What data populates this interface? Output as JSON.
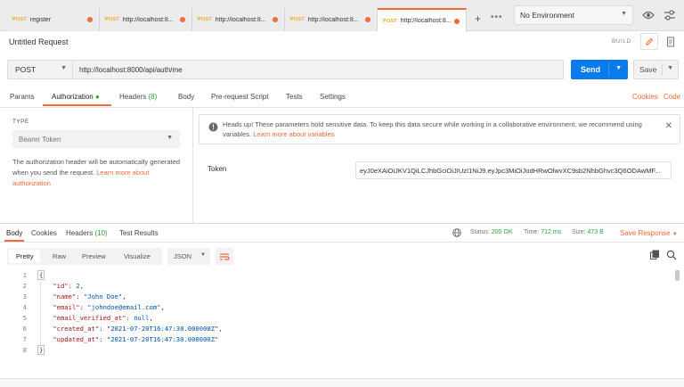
{
  "tabs": [
    {
      "method": "POST",
      "label": "register"
    },
    {
      "method": "POST",
      "label": "http://localhost:8..."
    },
    {
      "method": "POST",
      "label": "http://localhost:8..."
    },
    {
      "method": "POST",
      "label": "http://localhost:8..."
    },
    {
      "method": "POST",
      "label": "http://localhost:8..."
    }
  ],
  "tabbar": {
    "plus": "+",
    "more": "•••"
  },
  "environment": {
    "selected": "No Environment"
  },
  "request": {
    "title": "Untitled Request",
    "build_label": "BUILD",
    "method": "POST",
    "url": "http://localhost:8000/api/auth/me",
    "send_label": "Send",
    "save_label": "Save"
  },
  "request_tabs": {
    "params": "Params",
    "authorization": "Authorization",
    "headers": "Headers",
    "headers_count": "(8)",
    "body": "Body",
    "pre_request": "Pre-request Script",
    "tests": "Tests",
    "settings": "Settings",
    "cookies": "Cookies",
    "code": "Code"
  },
  "auth": {
    "type_label": "TYPE",
    "type_value": "Bearer Token",
    "desc_text": "The authorization header will be automatically generated when you send the request. ",
    "desc_link": "Learn more about authorization",
    "warning_text": "Heads up! These parameters hold sensitive data. To keep this data secure while working in a collaborative environment, we recommend using variables. ",
    "warning_link": "Learn more about variables",
    "token_label": "Token",
    "token_value": "eyJ0eXAiOiJKV1QiLCJhbGciOiJIUzI1NiJ9.eyJpc3MiOiJodHRwOlwvXC9sb2NhbGhvc3Q6ODAwMF..."
  },
  "response_tabs": {
    "body": "Body",
    "cookies": "Cookies",
    "headers": "Headers",
    "headers_count": "(10)",
    "test_results": "Test Results"
  },
  "response_status": {
    "status_label": "Status:",
    "status_value": "200 OK",
    "time_label": "Time:",
    "time_value": "712 ms",
    "size_label": "Size:",
    "size_value": "473 B",
    "save_response": "Save Response"
  },
  "response_toolbar": {
    "pretty": "Pretty",
    "raw": "Raw",
    "preview": "Preview",
    "visualize": "Visualize",
    "format": "JSON"
  },
  "response_body": {
    "line_numbers": [
      "1",
      "2",
      "3",
      "4",
      "5",
      "6",
      "7",
      "8"
    ],
    "open_brace": "{",
    "close_brace": "}",
    "fields": [
      {
        "key": "\"id\"",
        "value": "2",
        "type": "num",
        "comma": ","
      },
      {
        "key": "\"name\"",
        "value": "\"John Doe\"",
        "type": "str",
        "comma": ","
      },
      {
        "key": "\"email\"",
        "value": "\"johndoe@email.com\"",
        "type": "str",
        "comma": ","
      },
      {
        "key": "\"email_verified_at\"",
        "value": "null",
        "type": "kw",
        "comma": ","
      },
      {
        "key": "\"created_at\"",
        "value": "\"2021-07-20T16:47:30.000000Z\"",
        "type": "str",
        "comma": ","
      },
      {
        "key": "\"updated_at\"",
        "value": "\"2021-07-20T16:47:30.000000Z\"",
        "type": "str",
        "comma": ""
      }
    ]
  },
  "colors": {
    "accent": "#f26b3a",
    "send": "#097bed",
    "status_ok": "#2f9e44",
    "method": "#f5a623"
  }
}
